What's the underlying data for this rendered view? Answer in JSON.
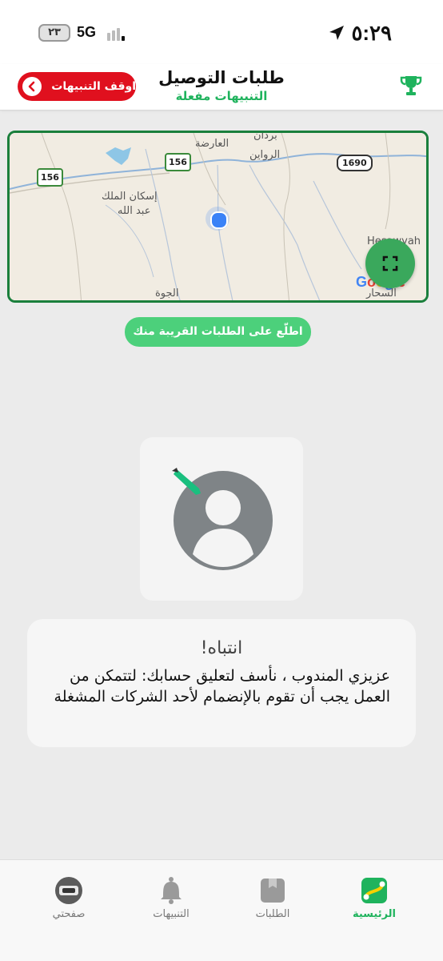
{
  "status_bar": {
    "time": "٥:٢٩",
    "network": "5G",
    "battery": "٢٣"
  },
  "header": {
    "title": "طلبات التوصيل",
    "subtitle": "التنبيهات مفعلة",
    "stop_button_label": "اوقف التنبيهات"
  },
  "map": {
    "labels": [
      "العارضة",
      "الرواين",
      "برذان",
      "إسكان الملك",
      "عبد الله",
      "الجوة",
      "السحار",
      "Hesawyah"
    ],
    "road_badges": [
      "156",
      "156",
      "1690"
    ],
    "google_logo": "Google"
  },
  "nearby_button_label": "اطلّع على الطلبات القريبة منك",
  "alert": {
    "title": "انتباه!",
    "body": "عزيزي المندوب ، نأسف لتعليق حسابك: لتتمكن من العمل يجب أن تقوم بالإنضمام لأحد الشركات المشغلة"
  },
  "bottom_nav": {
    "items": [
      {
        "label": "صفحتي",
        "icon": "profile-photo-icon"
      },
      {
        "label": "التنبيهات",
        "icon": "bell-icon"
      },
      {
        "label": "الطلبات",
        "icon": "box-icon"
      },
      {
        "label": "الرئيسية",
        "icon": "route-icon",
        "active": true
      }
    ]
  },
  "colors": {
    "accent_green": "#1fb35d",
    "stop_red": "#e0101e",
    "map_border": "#1a7f3c",
    "nearby_green": "#4cd07b"
  }
}
